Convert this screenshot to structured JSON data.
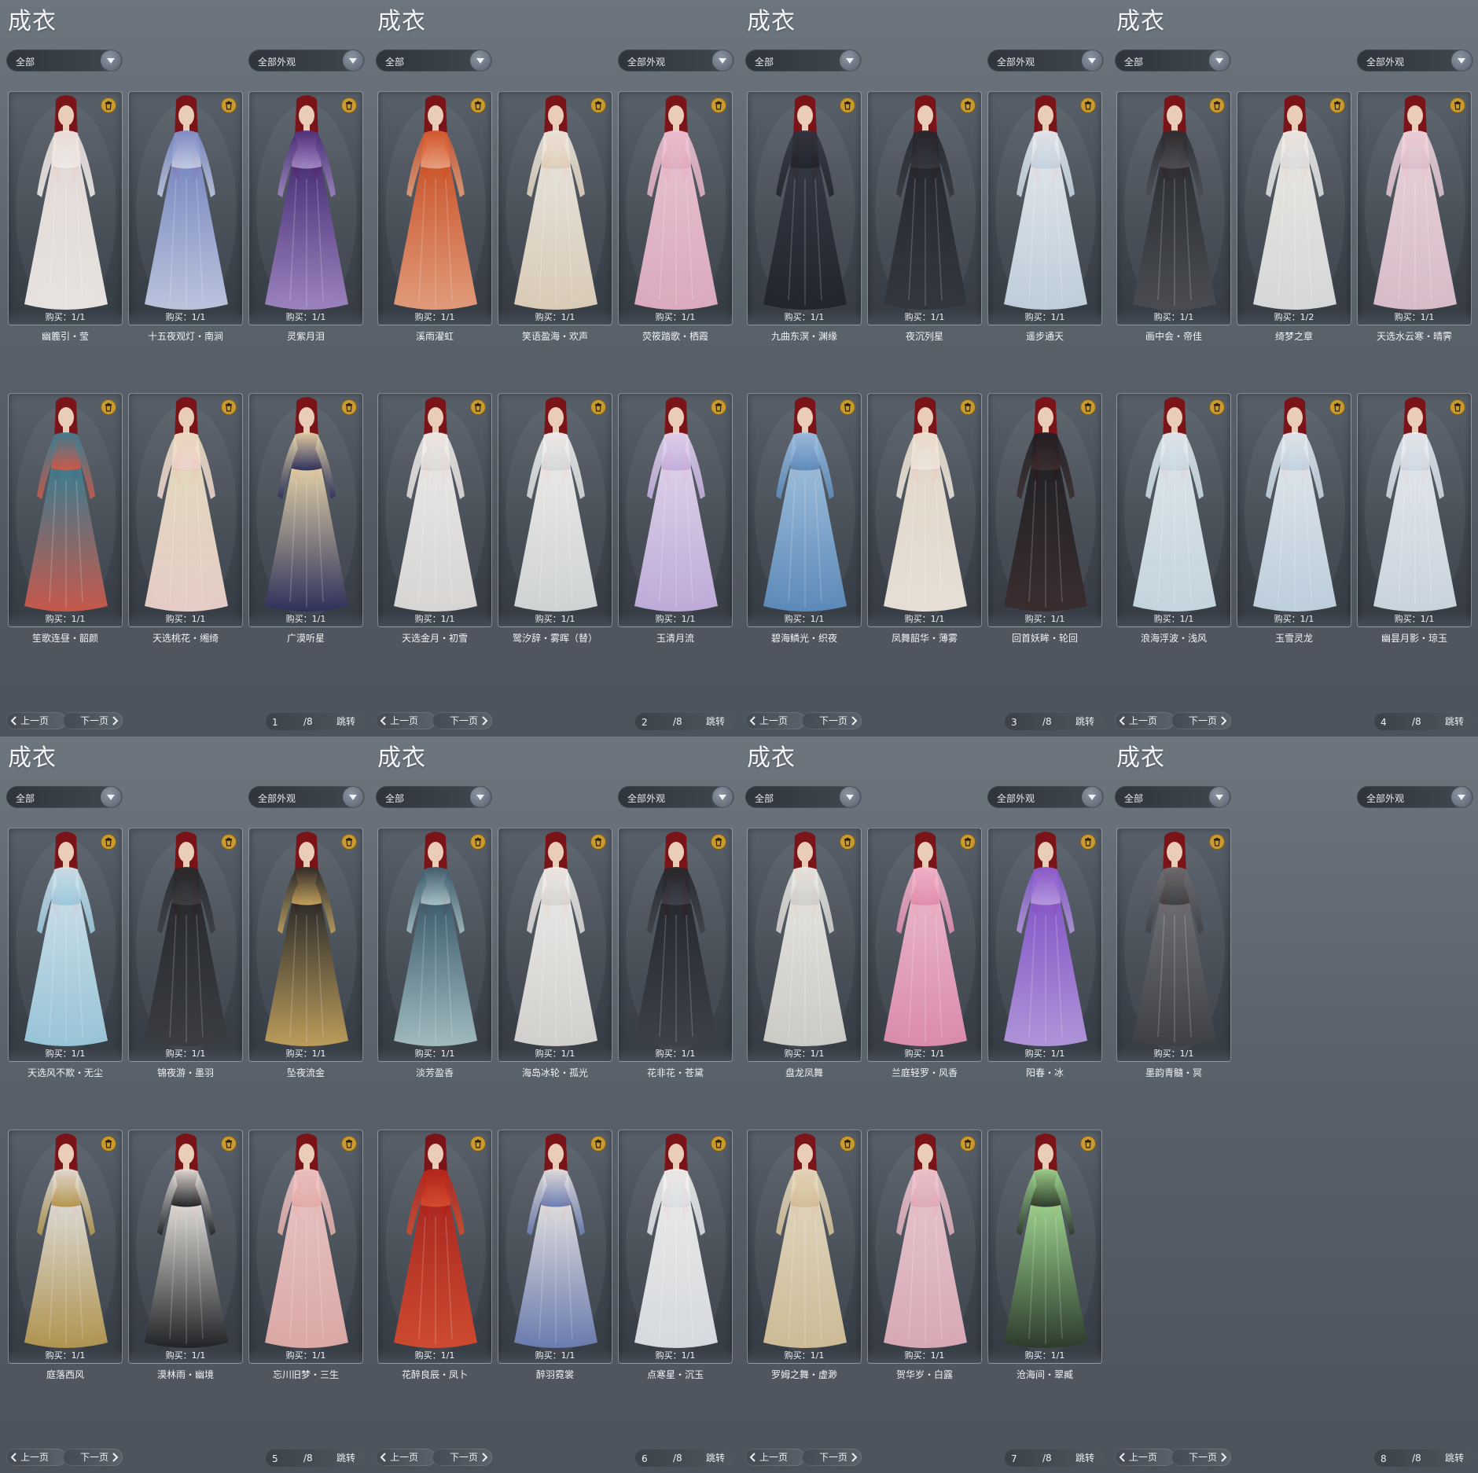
{
  "panels": [
    {
      "title": "成衣",
      "filter_category": "全部",
      "filter_appearance": "全部外观",
      "items": [
        {
          "name": "幽簏引・莹",
          "buy": "购买：1/1",
          "colors": [
            "#efe6e1",
            "#f5f0ec"
          ]
        },
        {
          "name": "十五夜观灯・南涧",
          "buy": "购买：1/1",
          "colors": [
            "#7f8fca",
            "#c6cfe9"
          ]
        },
        {
          "name": "灵紫月泪",
          "buy": "购买：1/1",
          "colors": [
            "#4c2f7a",
            "#a489c8"
          ]
        },
        {
          "name": "笙歌连昼・韶颜",
          "buy": "购买：1/1",
          "colors": [
            "#3c7f93",
            "#d25a4a"
          ]
        },
        {
          "name": "天选桃花・缃绮",
          "buy": "购买：1/1",
          "colors": [
            "#efe2c6",
            "#f3d8d1"
          ]
        },
        {
          "name": "广漠听星",
          "buy": "购买：1/1",
          "colors": [
            "#e8d6ab",
            "#2c2f5c"
          ]
        }
      ],
      "prev": "上一页",
      "next": "下一页",
      "page": "1",
      "total": "/8",
      "jump": "跳转"
    },
    {
      "title": "成衣",
      "filter_category": "全部",
      "filter_appearance": "全部外观",
      "items": [
        {
          "name": "溪雨濯虹",
          "buy": "购买：1/1",
          "colors": [
            "#d5582b",
            "#eea27f"
          ]
        },
        {
          "name": "笑语盈海・欢声",
          "buy": "购买：1/1",
          "colors": [
            "#f1ece2",
            "#e6d6bf"
          ]
        },
        {
          "name": "荧筱踏歌・栖霞",
          "buy": "购买：1/1",
          "colors": [
            "#f1c6d6",
            "#e8b2c7"
          ]
        },
        {
          "name": "天选金月・初雪",
          "buy": "购买：1/1",
          "colors": [
            "#f3f1ee",
            "#e5e2df"
          ]
        },
        {
          "name": "鹭汐辞・雾晖（替）",
          "buy": "购买：1/1",
          "colors": [
            "#f4f3f0",
            "#dcdfe0"
          ]
        },
        {
          "name": "玉清月流",
          "buy": "购买：1/1",
          "colors": [
            "#e6d8f2",
            "#c9b3e4"
          ]
        }
      ],
      "prev": "上一页",
      "next": "下一页",
      "page": "2",
      "total": "/8",
      "jump": "跳转"
    },
    {
      "title": "成衣",
      "filter_category": "全部",
      "filter_appearance": "全部外观",
      "items": [
        {
          "name": "九曲东溟・渊缘",
          "buy": "购买：1/1",
          "colors": [
            "#2f3440",
            "#1f232b"
          ]
        },
        {
          "name": "夜沉列星",
          "buy": "购买：1/1",
          "colors": [
            "#23262c",
            "#33363d"
          ]
        },
        {
          "name": "遥步通天",
          "buy": "购买：1/1",
          "colors": [
            "#e8eef3",
            "#c9d9e6"
          ]
        },
        {
          "name": "碧海鳞光・织夜",
          "buy": "购买：1/1",
          "colors": [
            "#9fc3e3",
            "#5e8fc1"
          ]
        },
        {
          "name": "凤舞韶华・薄雾",
          "buy": "购买：1/1",
          "colors": [
            "#efe3d4",
            "#f4ece1"
          ]
        },
        {
          "name": "回首妖眸・轮回",
          "buy": "购买：1/1",
          "colors": [
            "#1e1e22",
            "#3a2b2c"
          ]
        }
      ],
      "prev": "上一页",
      "next": "下一页",
      "page": "3",
      "total": "/8",
      "jump": "跳转"
    },
    {
      "title": "成衣",
      "filter_category": "全部",
      "filter_appearance": "全部外观",
      "items": [
        {
          "name": "画中会・帝佳",
          "buy": "购买：1/1",
          "colors": [
            "#2a2c30",
            "#4b4d52"
          ]
        },
        {
          "name": "绮梦之章",
          "buy": "购买：1/2",
          "colors": [
            "#f1efea",
            "#e2e4e4"
          ]
        },
        {
          "name": "天选水云寒・晴霁",
          "buy": "购买：1/1",
          "colors": [
            "#f1d7df",
            "#e4c6d3"
          ]
        },
        {
          "name": "浪海浮波・浅风",
          "buy": "购买：1/1",
          "colors": [
            "#e4eef3",
            "#cfe0ea"
          ]
        },
        {
          "name": "玉雪灵龙",
          "buy": "购买：1/1",
          "colors": [
            "#e6eef4",
            "#c7d9e8"
          ]
        },
        {
          "name": "幽昙月影・琼玉",
          "buy": "购买：1/1",
          "colors": [
            "#eaf0f5",
            "#d5e0ea"
          ]
        }
      ],
      "prev": "上一页",
      "next": "下一页",
      "page": "4",
      "total": "/8",
      "jump": "跳转"
    },
    {
      "title": "成衣",
      "filter_category": "全部",
      "filter_appearance": "全部外观",
      "items": [
        {
          "name": "天选风不欺・无尘",
          "buy": "购买：1/1",
          "colors": [
            "#cfe6f0",
            "#9fcfe3"
          ]
        },
        {
          "name": "锦夜游・墨羽",
          "buy": "购买：1/1",
          "colors": [
            "#25272b",
            "#3a3c40"
          ]
        },
        {
          "name": "坠夜流金",
          "buy": "购买：1/1",
          "colors": [
            "#2b2a27",
            "#c6a45c"
          ]
        },
        {
          "name": "庭落西风",
          "buy": "购买：1/1",
          "colors": [
            "#e6e2da",
            "#b99a4f"
          ]
        },
        {
          "name": "漠林雨・幽境",
          "buy": "购买：1/1",
          "colors": [
            "#e8e4de",
            "#1f2124"
          ]
        },
        {
          "name": "忘川旧梦・三生",
          "buy": "购买：1/1",
          "colors": [
            "#f0c8c6",
            "#e8b1ad"
          ]
        }
      ],
      "prev": "上一页",
      "next": "下一页",
      "page": "5",
      "total": "/8",
      "jump": "跳转"
    },
    {
      "title": "成衣",
      "filter_category": "全部",
      "filter_appearance": "全部外观",
      "items": [
        {
          "name": "淡芳盈香",
          "buy": "购买：1/1",
          "colors": [
            "#3d5f70",
            "#a9c4c8"
          ]
        },
        {
          "name": "海岛冰轮・孤光",
          "buy": "购买：1/1",
          "colors": [
            "#f2f1ee",
            "#dedcd8"
          ]
        },
        {
          "name": "花非花・苍黛",
          "buy": "购买：1/1",
          "colors": [
            "#23262b",
            "#3d4048"
          ]
        },
        {
          "name": "花醉良辰・凤卜",
          "buy": "购买：1/1",
          "colors": [
            "#b3251b",
            "#d94b2d"
          ]
        },
        {
          "name": "醉羽霓裳",
          "buy": "购买：1/1",
          "colors": [
            "#e8e6e6",
            "#6d7fb6"
          ]
        },
        {
          "name": "点寒星・沉玉",
          "buy": "购买：1/1",
          "colors": [
            "#f3f3f2",
            "#e3e6ea"
          ]
        }
      ],
      "prev": "上一页",
      "next": "下一页",
      "page": "6",
      "total": "/8",
      "jump": "跳转"
    },
    {
      "title": "成衣",
      "filter_category": "全部",
      "filter_appearance": "全部外观",
      "items": [
        {
          "name": "盘龙凤舞",
          "buy": "购买：1/1",
          "colors": [
            "#ecebe6",
            "#d7d6d0"
          ]
        },
        {
          "name": "兰庭轻罗・风香",
          "buy": "购买：1/1",
          "colors": [
            "#f4b9cf",
            "#e891b3"
          ]
        },
        {
          "name": "阳春・冰",
          "buy": "购买：1/1",
          "colors": [
            "#8a5ad1",
            "#b89be4"
          ]
        },
        {
          "name": "罗姆之舞・虚渺",
          "buy": "购买：1/1",
          "colors": [
            "#e9dcc1",
            "#d9c59c"
          ]
        },
        {
          "name": "贺华岁・白露",
          "buy": "购买：1/1",
          "colors": [
            "#efc9d2",
            "#e5b1bd"
          ]
        },
        {
          "name": "沧海间・翠臧",
          "buy": "购买：1/1",
          "colors": [
            "#9fd88e",
            "#2b3a2a"
          ]
        }
      ],
      "prev": "上一页",
      "next": "下一页",
      "page": "7",
      "total": "/8",
      "jump": "跳转"
    },
    {
      "title": "成衣",
      "filter_category": "全部",
      "filter_appearance": "全部外观",
      "items": [
        {
          "name": "墨韵青髓・冥",
          "buy": "购买：1/1",
          "colors": [
            "#6d6e72",
            "#3f4044"
          ]
        }
      ],
      "prev": "上一页",
      "next": "下一页",
      "page": "8",
      "total": "/8",
      "jump": "跳转"
    }
  ],
  "theme": {
    "trash_icon_color": "#c99a2e",
    "hair_color": "#7a1418",
    "skin_color": "#e9cdb8"
  }
}
